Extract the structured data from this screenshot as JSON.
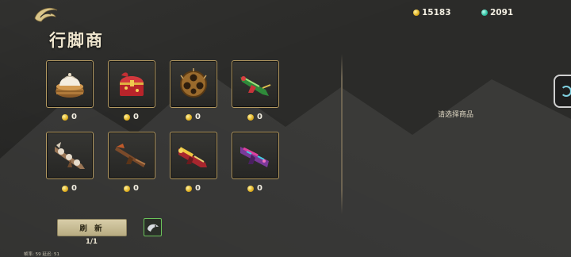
{
  "header": {
    "title": "行脚商",
    "back_icon": "swirl-back-icon"
  },
  "currency": {
    "coins": "15183",
    "gems": "2091",
    "coin_color": "#e0b020",
    "gem_color": "#2fbfa0"
  },
  "shop": {
    "items": [
      {
        "name": "steamed-bun-basket-icon",
        "price": "0"
      },
      {
        "name": "treasure-chest-icon",
        "price": "0"
      },
      {
        "name": "spiked-shell-icon",
        "price": "0"
      },
      {
        "name": "green-dragon-gun-icon",
        "price": "0"
      },
      {
        "name": "bone-cannon-icon",
        "price": "0"
      },
      {
        "name": "bronze-rifle-icon",
        "price": "0"
      },
      {
        "name": "golden-launcher-icon",
        "price": "0"
      },
      {
        "name": "purple-blaster-icon",
        "price": "0"
      }
    ],
    "refresh_label": "刷 新",
    "refresh_count": "1/1",
    "select_hint": "请选择商品"
  },
  "debug": {
    "text": "帧率: 59  延迟: 51"
  }
}
